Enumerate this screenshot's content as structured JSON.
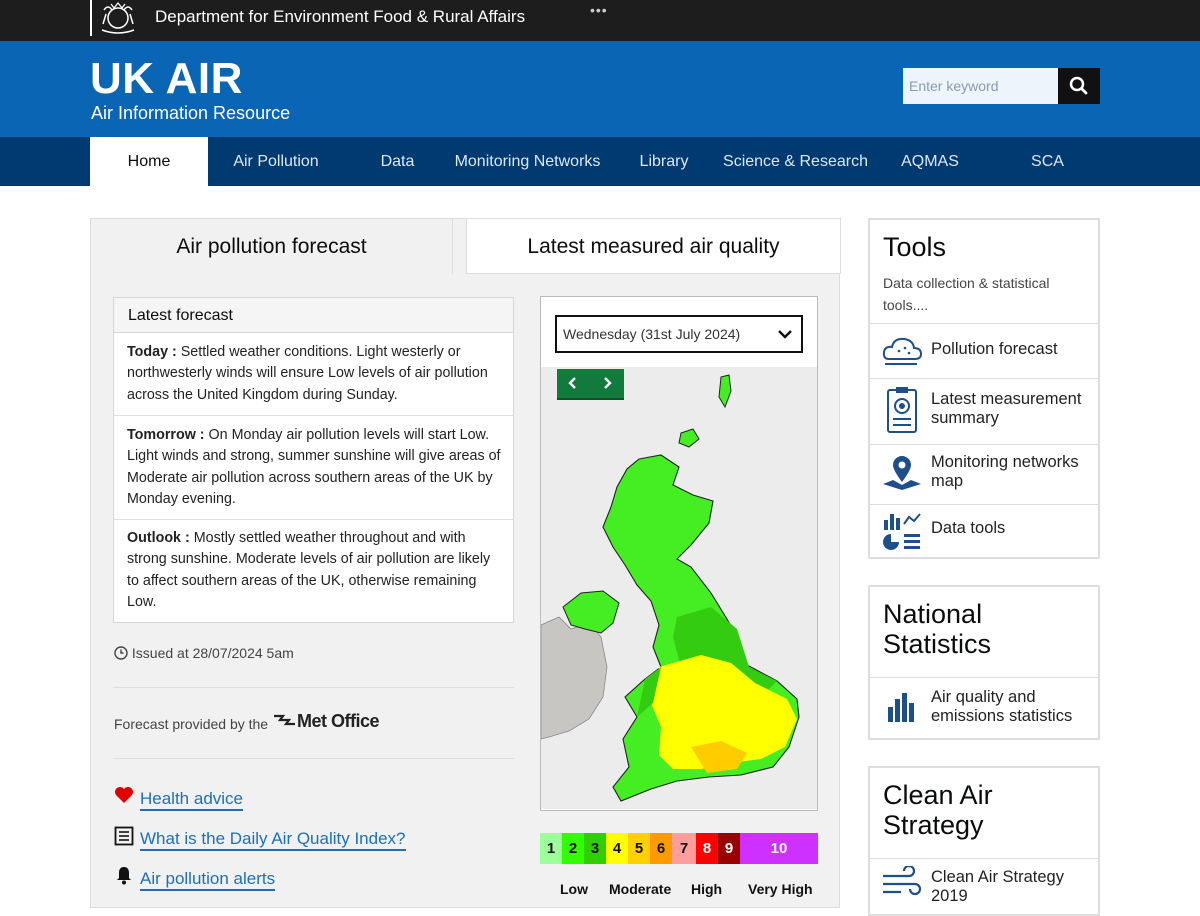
{
  "topbar": {
    "department": "Department for Environment Food & Rural Affairs",
    "dots": "•••"
  },
  "header": {
    "title": "UK AIR",
    "subtitle": "Air Information Resource",
    "search_placeholder": "Enter keyword"
  },
  "nav": [
    "Home",
    "Air Pollution",
    "Data",
    "Monitoring Networks",
    "Library",
    "Science & Research",
    "AQMAS",
    "SCA"
  ],
  "tabs": [
    "Air pollution forecast",
    "Latest measured air quality"
  ],
  "forecast": {
    "heading": "Latest forecast",
    "items": [
      {
        "label": "Today :",
        "text": " Settled weather conditions. Light westerly or northwesterly winds will ensure Low levels of air pollution across the United Kingdom during Sunday."
      },
      {
        "label": "Tomorrow :",
        "text": " On Monday air pollution levels will start Low. Light winds and strong, summer sunshine will give areas of Moderate air pollution across southern areas of the UK by Monday evening."
      },
      {
        "label": "Outlook :",
        "text": " Mostly settled weather throughout and with strong sunshine. Moderate levels of air pollution are likely to affect southern areas of the UK, otherwise remaining Low."
      }
    ],
    "issued": "Issued at 28/07/2024 5am",
    "provided_by": "Forecast provided by the",
    "provider": "Met Office"
  },
  "links": [
    "Health advice",
    "What is the Daily Air Quality Index?",
    "Air pollution alerts"
  ],
  "map": {
    "selected_date": "Wednesday (31st July 2024)"
  },
  "legend": {
    "cells": [
      {
        "label": "1",
        "color": "#9cff9c"
      },
      {
        "label": "2",
        "color": "#31ff00"
      },
      {
        "label": "3",
        "color": "#31cf00"
      },
      {
        "label": "4",
        "color": "#ffff00"
      },
      {
        "label": "5",
        "color": "#ffcf00"
      },
      {
        "label": "6",
        "color": "#ff9a00"
      },
      {
        "label": "7",
        "color": "#ff9c9c"
      },
      {
        "label": "8",
        "color": "#ff0000"
      },
      {
        "label": "9",
        "color": "#990000"
      },
      {
        "label": "10",
        "color": "#ce30ff"
      }
    ],
    "bands": [
      "Low",
      "Moderate",
      "High",
      "Very High"
    ]
  },
  "tools": {
    "title": "Tools",
    "description": "Data collection & statistical tools....",
    "items": [
      "Pollution forecast",
      "Latest measurement summary",
      "Monitoring networks map",
      "Data tools"
    ]
  },
  "national_statistics": {
    "title": "National Statistics",
    "items": [
      "Air quality and emissions statistics"
    ]
  },
  "clean_air": {
    "title": "Clean Air Strategy",
    "items": [
      "Clean Air Strategy 2019"
    ]
  },
  "colors": {
    "header_blue": "#0a66b5",
    "nav_navy": "#003a70",
    "link_blue": "#1d70b8",
    "arrow_green": "#127a3b"
  }
}
